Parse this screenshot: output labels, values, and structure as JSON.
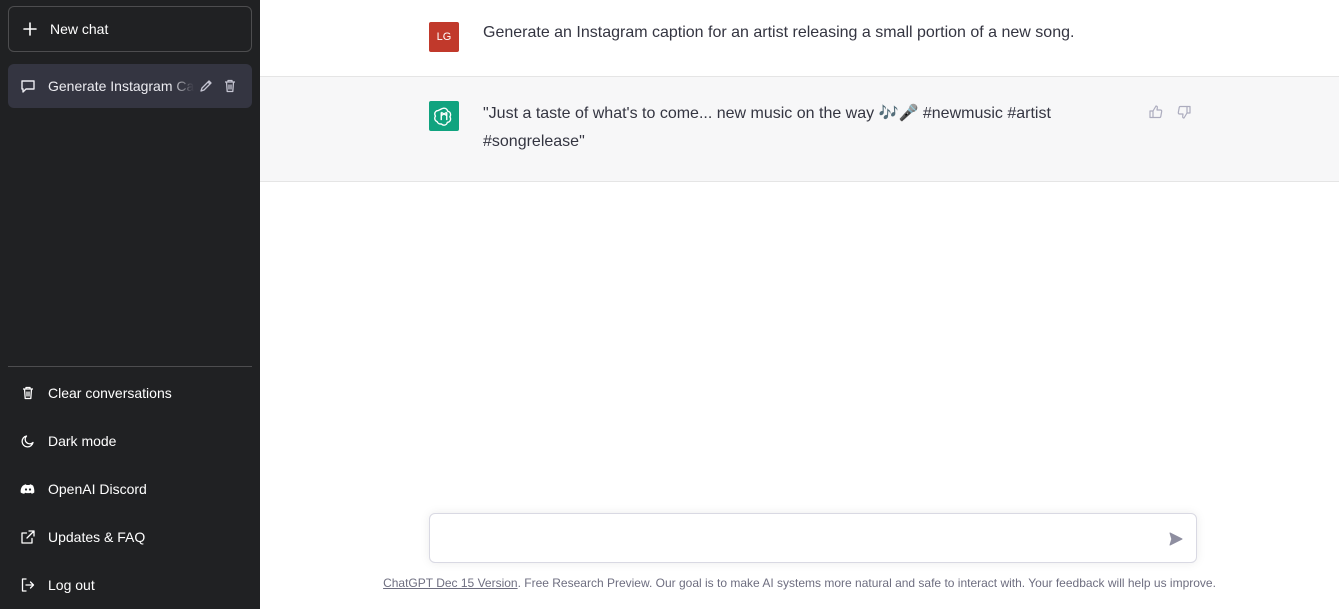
{
  "sidebar": {
    "new_chat_label": "New chat",
    "conversations": [
      {
        "label": "Generate Instagram Caption"
      }
    ],
    "menu": {
      "clear": "Clear conversations",
      "dark_mode": "Dark mode",
      "discord": "OpenAI Discord",
      "updates": "Updates & FAQ",
      "logout": "Log out"
    }
  },
  "chat": {
    "user_avatar_initials": "LG",
    "user_message": "Generate an Instagram caption for an artist releasing a small portion of a new song.",
    "assistant_message": "\"Just a taste of what's to come... new music on the way 🎶🎤 #newmusic #artist #songrelease\""
  },
  "input": {
    "placeholder": ""
  },
  "footer": {
    "version_link": "ChatGPT Dec 15 Version",
    "text": ". Free Research Preview. Our goal is to make AI systems more natural and safe to interact with. Your feedback will help us improve."
  },
  "colors": {
    "sidebar_bg": "#202123",
    "selected_item_bg": "#343541",
    "user_avatar_bg": "#c1392b",
    "assistant_avatar_bg": "#10a37f",
    "assistant_row_bg": "#f7f7f8"
  },
  "icons": {
    "new_chat": "plus-icon",
    "conversation": "chat-bubble-icon",
    "edit": "pencil-icon",
    "delete": "trash-icon",
    "clear": "trash-icon",
    "dark_mode": "moon-icon",
    "discord": "discord-icon",
    "updates": "external-link-icon",
    "logout": "logout-icon",
    "thumbs_up": "thumbs-up-icon",
    "thumbs_down": "thumbs-down-icon",
    "send": "send-icon",
    "assistant_logo": "openai-logo-icon"
  }
}
